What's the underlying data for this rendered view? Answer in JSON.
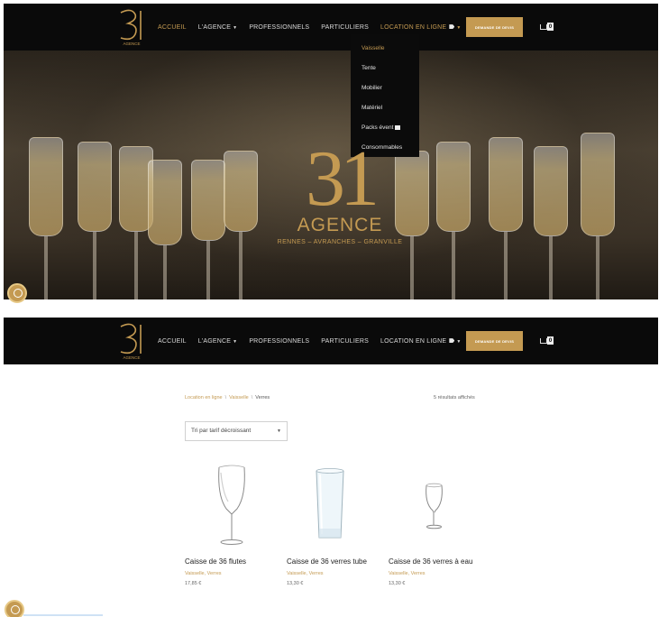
{
  "brand": {
    "logo_text": "31",
    "logo_sub": "AGENCE",
    "accent_color": "#c49a52"
  },
  "nav": {
    "items": [
      {
        "label": "ACCUEIL",
        "active": true
      },
      {
        "label": "L'AGENCE",
        "dropdown": true
      },
      {
        "label": "PROFESSIONNELS"
      },
      {
        "label": "PARTICULIERS"
      },
      {
        "label": "LOCATION EN LIGNE",
        "icon": "tag-icon",
        "dropdown": true
      }
    ],
    "quote_button": "DEMANDE DE DEVIS",
    "cart_icon": "cart-icon",
    "cart_count": "0"
  },
  "dropdown": {
    "items": [
      {
        "label": "Vaisselle",
        "active": true
      },
      {
        "label": "Tente"
      },
      {
        "label": "Mobilier"
      },
      {
        "label": "Matériel"
      },
      {
        "label": "Packs évent",
        "icon": "gift-icon"
      },
      {
        "label": "Consommables"
      }
    ]
  },
  "hero": {
    "logo_number": "31",
    "logo_word": "AGENCE",
    "cities": "RENNES – AVRANCHES – GRANVILLE"
  },
  "shop": {
    "breadcrumb": [
      "Location en ligne",
      "Vaisselle",
      "Verres"
    ],
    "results_count": "5 résultats affichés",
    "sort_label": "Tri par tarif décroissant",
    "products": [
      {
        "name": "Caisse de 36 flutes",
        "categories": "Vaisselle, Verres",
        "price": "17,85 €",
        "icon": "flute-glass-image"
      },
      {
        "name": "Caisse de 36 verres tube",
        "categories": "Vaisselle, Verres",
        "price": "13,30 €",
        "icon": "tube-glass-image"
      },
      {
        "name": "Caisse de 36 verres à eau",
        "categories": "Vaisselle, Verres",
        "price": "13,30 €",
        "icon": "water-glass-image"
      }
    ]
  }
}
